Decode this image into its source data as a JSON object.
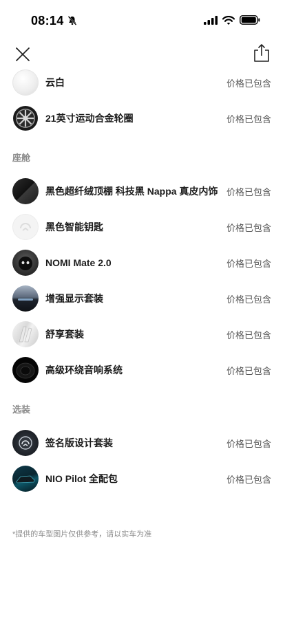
{
  "status": {
    "time": "08:14"
  },
  "items_top": [
    {
      "label": "云白",
      "price": "价格已包含",
      "thumb": "white"
    },
    {
      "label": "21英寸运动合金轮圈",
      "price": "价格已包含",
      "thumb": "wheel"
    }
  ],
  "section_cabin": {
    "title": "座舱",
    "items": [
      {
        "label": "黑色超纤绒顶棚 科技黑 Nappa 真皮内饰",
        "price": "价格已包含",
        "thumb": "black"
      },
      {
        "label": "黑色智能钥匙",
        "price": "价格已包含",
        "thumb": "key"
      },
      {
        "label": "NOMI Mate 2.0",
        "price": "价格已包含",
        "thumb": "nomi"
      },
      {
        "label": "增强显示套装",
        "price": "价格已包含",
        "thumb": "hud"
      },
      {
        "label": "舒享套装",
        "price": "价格已包含",
        "thumb": "seat"
      },
      {
        "label": "高级环绕音响系统",
        "price": "价格已包含",
        "thumb": "speaker"
      }
    ]
  },
  "section_options": {
    "title": "选装",
    "items": [
      {
        "label": "签名版设计套装",
        "price": "价格已包含",
        "thumb": "sig"
      },
      {
        "label": "NIO Pilot 全配包",
        "price": "价格已包含",
        "thumb": "pilot"
      }
    ]
  },
  "disclaimer": "*提供的车型图片仅供参考，请以实车为准"
}
